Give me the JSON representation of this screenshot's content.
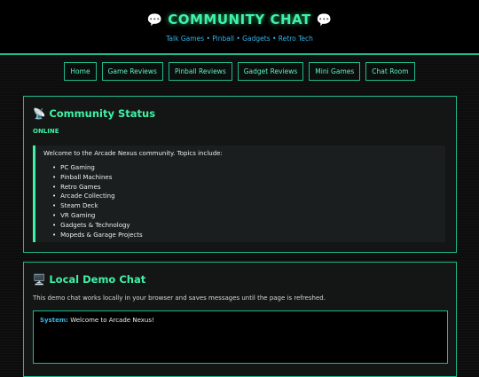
{
  "header": {
    "title": "COMMUNITY CHAT",
    "title_icon": "speech-bubble-icon",
    "tagline": "Talk Games • Pinball • Gadgets • Retro Tech"
  },
  "nav": [
    {
      "label": "Home"
    },
    {
      "label": "Game Reviews"
    },
    {
      "label": "Pinball Reviews"
    },
    {
      "label": "Gadget Reviews"
    },
    {
      "label": "Mini Games"
    },
    {
      "label": "Chat Room"
    }
  ],
  "status_card": {
    "icon": "satellite-antenna-icon",
    "title": "Community Status",
    "status": "ONLINE",
    "intro": "Welcome to the Arcade Nexus community. Topics include:",
    "topics": [
      "PC Gaming",
      "Pinball Machines",
      "Retro Games",
      "Arcade Collecting",
      "Steam Deck",
      "VR Gaming",
      "Gadgets & Technology",
      "Mopeds & Garage Projects"
    ]
  },
  "chat_card": {
    "icon": "desktop-computer-icon",
    "title": "Local Demo Chat",
    "description": "This demo chat works locally in your browser and saves messages until the page is refreshed.",
    "messages": [
      {
        "sender": "System:",
        "text": "Welcome to Arcade Nexus!"
      }
    ]
  },
  "colors": {
    "accent": "#3ff2a5",
    "border": "#1fb98c",
    "link_blue": "#36b6e8",
    "background": "#0d0d0d"
  }
}
